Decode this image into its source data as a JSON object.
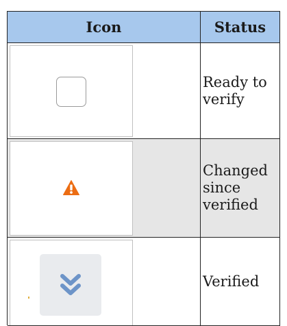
{
  "table": {
    "headers": {
      "icon": "Icon",
      "status": "Status"
    },
    "rows": [
      {
        "icon": "empty-checkbox-icon",
        "status": "Ready to\nverify"
      },
      {
        "icon": "warning-icon",
        "status": "Changed\nsince\nverified"
      },
      {
        "icon": "double-check-icon",
        "status": "Verified"
      }
    ]
  },
  "colors": {
    "header_bg": "#a7c8ed",
    "row_alt_bg": "#e6e6e6",
    "warning": "#ec6d13",
    "verified_chevron": "#6d94c8"
  }
}
